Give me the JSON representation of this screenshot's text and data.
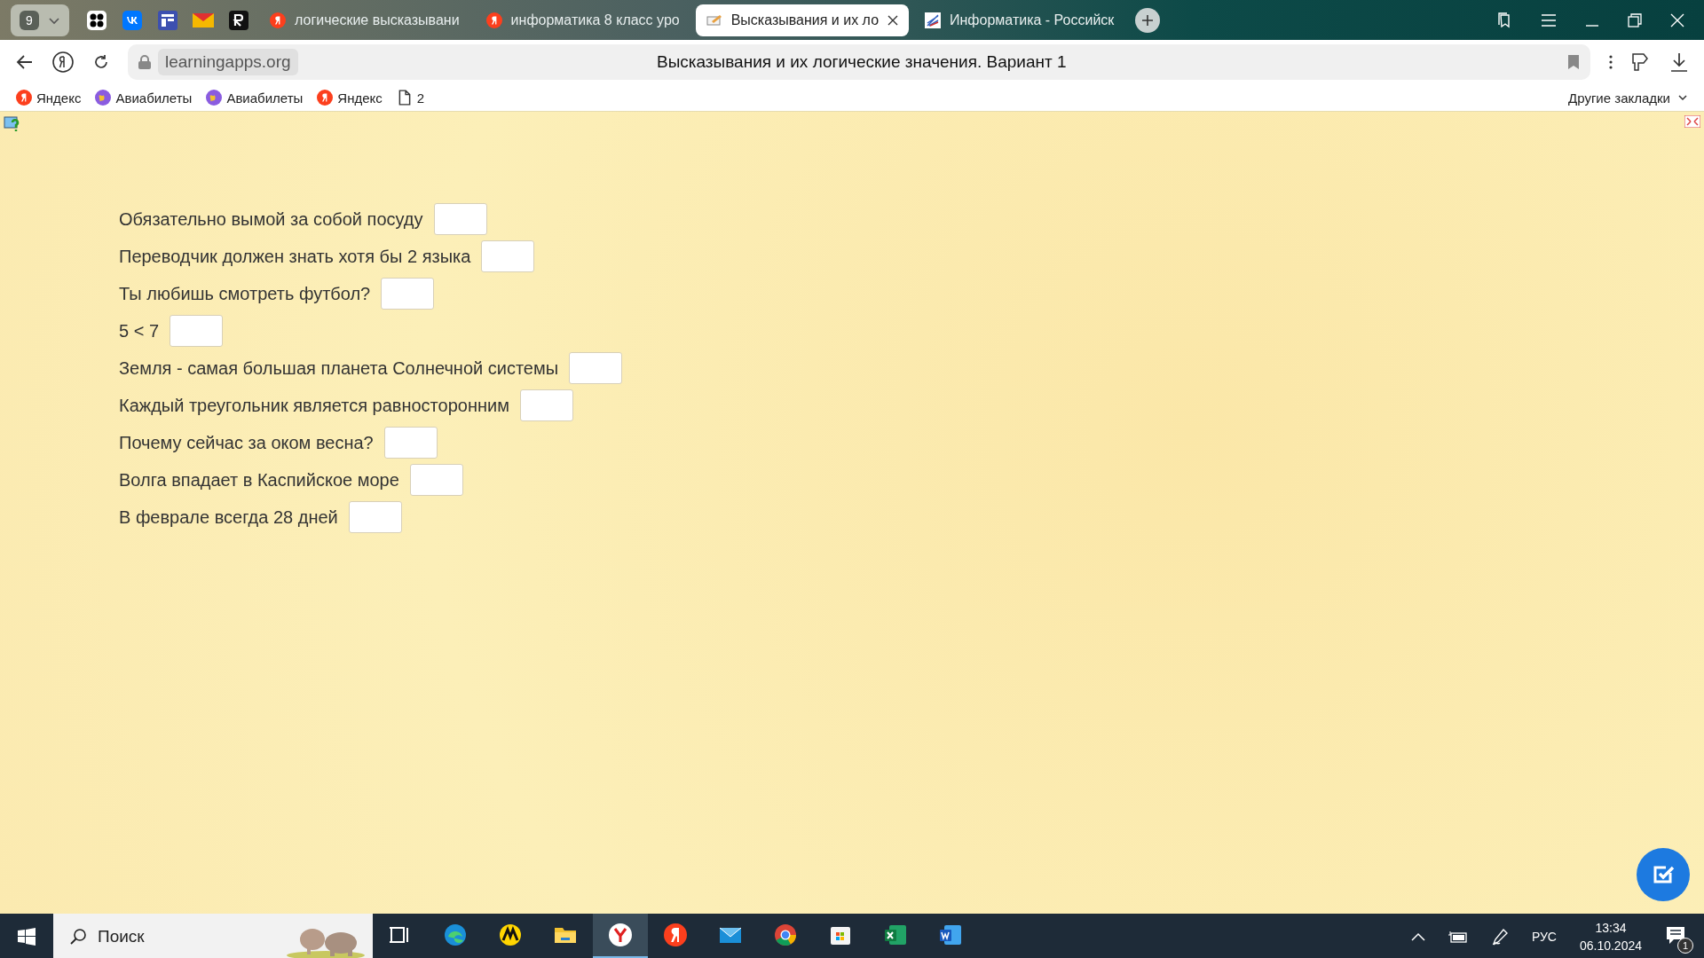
{
  "browser": {
    "tab_count": "9",
    "tabs": [
      {
        "title": "логические высказывани",
        "selected": false,
        "kind": "yandex"
      },
      {
        "title": "информатика 8 класс уро",
        "selected": false,
        "kind": "yandex"
      },
      {
        "title": "Высказывания и их ло",
        "selected": true,
        "kind": "page"
      },
      {
        "title": "Информатика - Российск",
        "selected": false,
        "kind": "site"
      }
    ],
    "address": "learningapps.org",
    "page_title": "Высказывания и их логические значения. Вариант 1",
    "bookmarks": [
      {
        "label": "Яндекс",
        "kind": "yandex"
      },
      {
        "label": "Авиабилеты",
        "kind": "globe"
      },
      {
        "label": "Авиабилеты",
        "kind": "globe"
      },
      {
        "label": "Яндекс",
        "kind": "yandex"
      },
      {
        "label": "2",
        "kind": "file"
      }
    ],
    "other_bookmarks": "Другие закладки"
  },
  "exercise": {
    "items": [
      {
        "text": "Обязательно вымой за собой посуду"
      },
      {
        "text": "Переводчик должен знать хотя бы 2 языка"
      },
      {
        "text": "Ты любишь смотреть футбол?"
      },
      {
        "text": "5 < 7"
      },
      {
        "text": "Земля - самая большая планета Солнечной системы"
      },
      {
        "text": "Каждый треугольник является равносторонним"
      },
      {
        "text": "Почему сейчас за оком весна?"
      },
      {
        "text": "Волга впадает в Каспийское море"
      },
      {
        "text": "В феврале всегда 28 дней"
      }
    ]
  },
  "taskbar": {
    "search_placeholder": "Поиск",
    "apps": [
      {
        "kind": "taskview",
        "selected": false
      },
      {
        "kind": "edge",
        "selected": false
      },
      {
        "kind": "market",
        "selected": false
      },
      {
        "kind": "explorer",
        "selected": false
      },
      {
        "kind": "ybrowser",
        "selected": true
      },
      {
        "kind": "yandex",
        "selected": false
      },
      {
        "kind": "mail",
        "selected": false
      },
      {
        "kind": "chrome",
        "selected": false
      },
      {
        "kind": "store",
        "selected": false
      },
      {
        "kind": "excel",
        "selected": false
      },
      {
        "kind": "word",
        "selected": false
      }
    ],
    "language": "РУС",
    "time": "13:34",
    "date": "06.10.2024",
    "notifications": "1"
  }
}
